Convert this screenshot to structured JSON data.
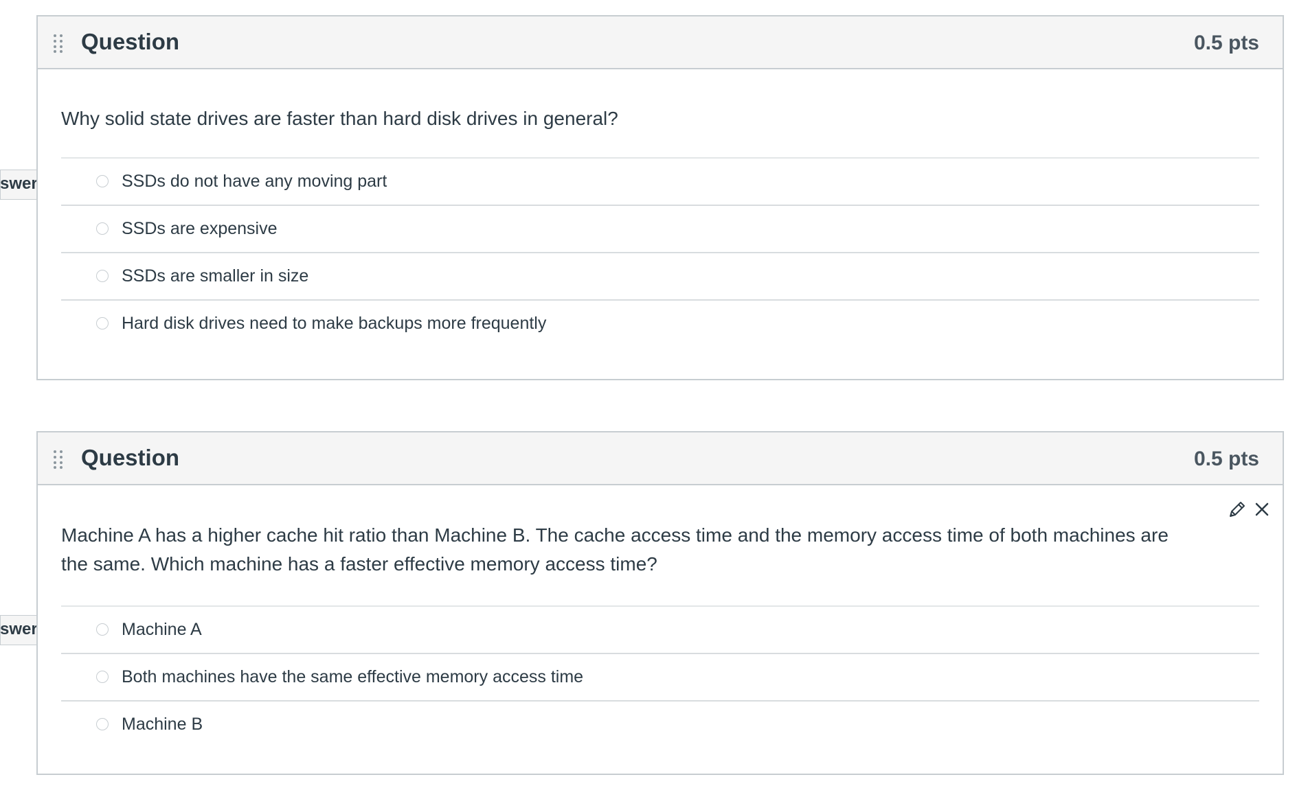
{
  "questions": [
    {
      "title": "Question",
      "points": "0.5 pts",
      "text": "Why solid state drives are faster than hard disk drives in general?",
      "answer_tag": "swer",
      "answers": [
        "SSDs do not have any moving part",
        "SSDs are expensive",
        "SSDs are smaller in size",
        "Hard disk drives need to make backups more frequently"
      ]
    },
    {
      "title": "Question",
      "points": "0.5 pts",
      "text": "Machine A has a higher cache hit ratio than Machine B. The cache access time and the memory access time of both machines are the same.  Which machine has a faster effective memory access time?",
      "answer_tag": "swer",
      "answers": [
        "Machine A",
        "Both machines have the same effective memory access time",
        "Machine B"
      ],
      "icons": [
        "pencil-icon",
        "close-icon"
      ]
    }
  ],
  "colors": {
    "border": "#c7cdd1",
    "header_bg": "#f5f5f5",
    "text": "#2d3b45"
  }
}
